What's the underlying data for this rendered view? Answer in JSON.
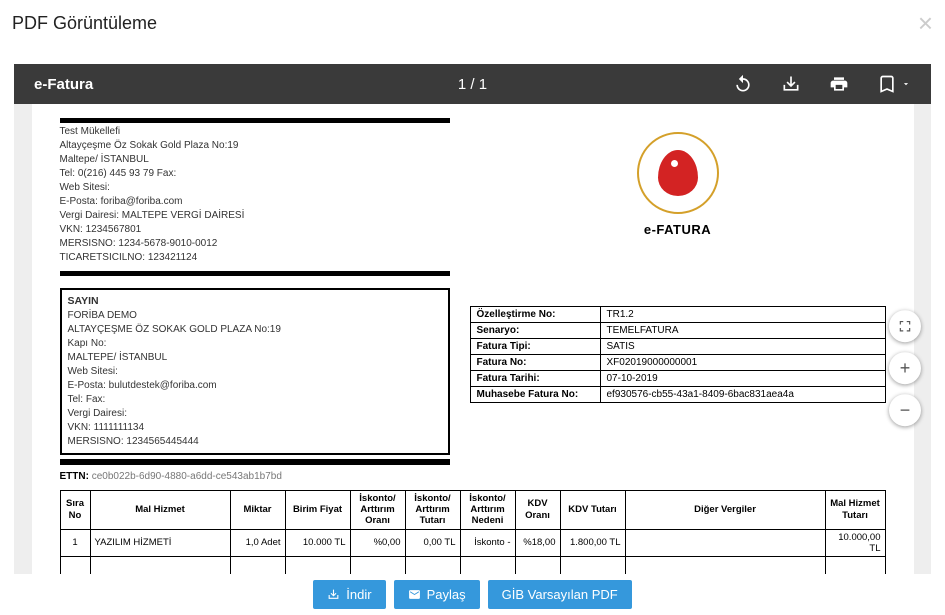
{
  "modal": {
    "title": "PDF Görüntüleme"
  },
  "toolbar": {
    "title": "e-Fatura",
    "page": "1 / 1"
  },
  "sender": {
    "name": "Test Mükellefi",
    "address": "Altayçeşme Öz Sokak Gold Plaza No:19",
    "city": " Maltepe/ İSTANBUL",
    "tel": "Tel: 0(216) 445 93 79 Fax:",
    "web": "Web Sitesi:",
    "email": "E-Posta: foriba@foriba.com",
    "vergi": "Vergi Dairesi: MALTEPE VERGİ DAİRESİ",
    "vkn": "VKN: 1234567801",
    "mersis": "MERSISNO: 1234-5678-9010-0012",
    "ticaret": "TICARETSICILNO: 123421124"
  },
  "doc_title": "e-FATURA",
  "recipient": {
    "sayin": "SAYIN",
    "name": "FORİBA DEMO",
    "address": "ALTAYÇEŞME ÖZ SOKAK GOLD PLAZA No:19",
    "kapi": "Kapı No:",
    "city": " MALTEPE/ İSTANBUL",
    "web": "Web Sitesi:",
    "email": "E-Posta: bulutdestek@foriba.com",
    "tel": "Tel: Fax:",
    "vergi": "Vergi Dairesi:",
    "vkn": "VKN: 1111111134",
    "mersis": "MERSISNO: 1234565445444"
  },
  "meta": {
    "ozellestirme_l": "Özelleştirme No:",
    "ozellestirme_v": "TR1.2",
    "senaryo_l": "Senaryo:",
    "senaryo_v": "TEMELFATURA",
    "tip_l": "Fatura Tipi:",
    "tip_v": "SATIS",
    "no_l": "Fatura No:",
    "no_v": "XF02019000000001",
    "tarih_l": "Fatura Tarihi:",
    "tarih_v": "07-10-2019",
    "muhasebe_l": "Muhasebe Fatura No:",
    "muhasebe_v": "ef930576-cb55-43a1-8409-6bac831aea4a"
  },
  "ettn": {
    "label": "ETTN: ",
    "value": "ce0b022b-6d90-4880-a6dd-ce543ab1b7bd"
  },
  "headers": {
    "sira": "Sıra No",
    "mal": "Mal Hizmet",
    "miktar": "Miktar",
    "bf": "Birim Fiyat",
    "iao": "İskonto/ Arttırım Oranı",
    "iat": "İskonto/ Arttırım Tutarı",
    "ian": "İskonto/ Arttırım Nedeni",
    "kdvo": "KDV Oranı",
    "kdvt": "KDV Tutarı",
    "dv": "Diğer Vergiler",
    "mht": "Mal Hizmet Tutarı"
  },
  "row": {
    "sira": "1",
    "mal": "YAZILIM HİZMETİ",
    "miktar": "1,0 Adet",
    "bf": "10.000 TL",
    "iao": "%0,00",
    "iat": "0,00 TL",
    "ian": "İskonto -",
    "kdvo": "%18,00",
    "kdvt": "1.800,00 TL",
    "dv": "",
    "mht": "10.000,00 TL"
  },
  "buttons": {
    "indir": "İndir",
    "paylas": "Paylaş",
    "gib": "GİB Varsayılan PDF"
  }
}
